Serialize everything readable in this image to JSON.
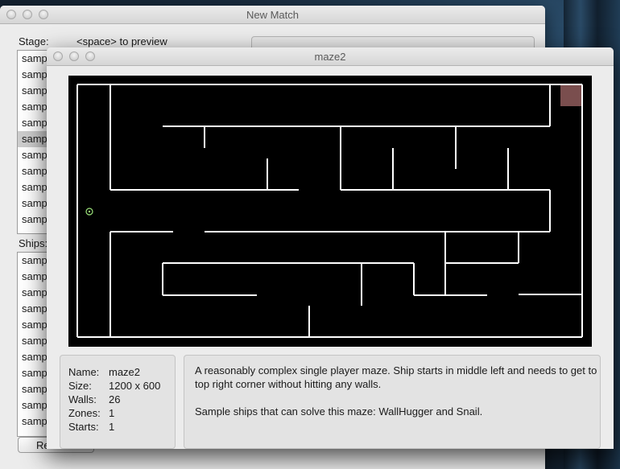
{
  "back_window": {
    "title": "New Match",
    "stage_label": "Stage:",
    "stage_hint": "<space> to preview",
    "stage_items": [
      "samp",
      "samp",
      "samp",
      "samp",
      "samp",
      "samp",
      "samp",
      "samp",
      "samp",
      "samp",
      "samp"
    ],
    "stage_selected_index": 5,
    "ships_label": "Ships:",
    "ship_items": [
      "samp",
      "samp",
      "samp",
      "samp",
      "samp",
      "samp",
      "samp",
      "samp",
      "samp",
      "samp",
      "samp"
    ],
    "bottom_button_label": "Re"
  },
  "preview_window": {
    "title": "maze2",
    "info": {
      "name_key": "Name:",
      "name": "maze2",
      "size_key": "Size:",
      "size": "1200 x 600",
      "walls_key": "Walls:",
      "walls": "26",
      "zones_key": "Zones:",
      "zones": "1",
      "starts_key": "Starts:",
      "starts": "1"
    },
    "description_1": "A reasonably complex single player maze. Ship starts in middle left and needs to get to top right corner without hitting any walls.",
    "description_2": "Sample ships that can solve this maze: WallHugger and Snail.",
    "colors": {
      "wall": "#ffffff",
      "zone": "#7a4e4e",
      "start": "#9be37a",
      "background": "#000000"
    }
  }
}
